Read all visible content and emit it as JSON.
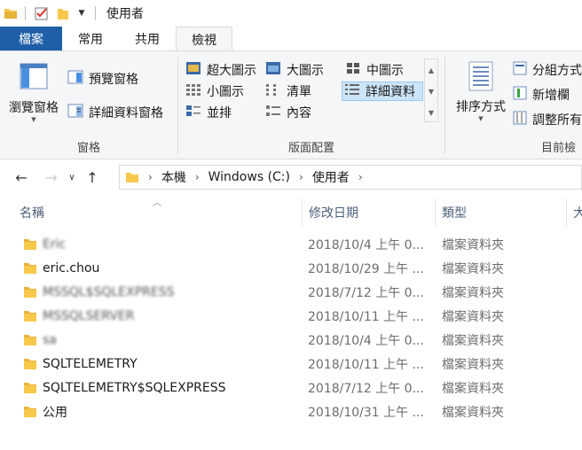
{
  "window": {
    "title": "使用者"
  },
  "quick_access": {
    "icons": [
      "folder-icon",
      "properties-check-icon",
      "new-folder-icon",
      "customize-dropdown-icon"
    ]
  },
  "ribbon_tabs": [
    {
      "label": "檔案"
    },
    {
      "label": "常用"
    },
    {
      "label": "共用"
    },
    {
      "label": "檢視",
      "active": true
    }
  ],
  "ribbon": {
    "panes": {
      "navigation_pane": "瀏覽窗格",
      "preview_pane": "預覽窗格",
      "details_pane": "詳細資料窗格",
      "group_label": "窗格"
    },
    "layout": {
      "items": [
        "超大圖示",
        "大圖示",
        "中圖示",
        "小圖示",
        "清單",
        "詳細資料",
        "並排",
        "內容"
      ],
      "selected": "詳細資料",
      "group_label": "版面配置"
    },
    "current_view": {
      "sort_by": "排序方式",
      "group_by": "分組方式",
      "add_columns": "新增欄",
      "size_all_columns": "調整所有",
      "group_label": "目前檢"
    }
  },
  "address_bar": {
    "breadcrumbs": [
      "本機",
      "Windows (C:)",
      "使用者"
    ]
  },
  "columns": {
    "name": "名稱",
    "date_modified": "修改日期",
    "type": "類型",
    "size": "大"
  },
  "files": [
    {
      "name": "Eric",
      "date": "2018/10/4 上午 0...",
      "type": "檔案資料夾",
      "blurred": true
    },
    {
      "name": "eric.chou",
      "date": "2018/10/29 上午 ...",
      "type": "檔案資料夾",
      "blurred": false
    },
    {
      "name": "MSSQL$SQLEXPRESS",
      "date": "2018/7/12 上午 0...",
      "type": "檔案資料夾",
      "blurred": true
    },
    {
      "name": "MSSQLSERVER",
      "date": "2018/10/11 上午 ...",
      "type": "檔案資料夾",
      "blurred": true
    },
    {
      "name": "sa",
      "date": "2018/10/4 上午 0...",
      "type": "檔案資料夾",
      "blurred": true
    },
    {
      "name": "SQLTELEMETRY",
      "date": "2018/10/11 上午 ...",
      "type": "檔案資料夾",
      "blurred": false
    },
    {
      "name": "SQLTELEMETRY$SQLEXPRESS",
      "date": "2018/7/12 上午 0...",
      "type": "檔案資料夾",
      "blurred": false
    },
    {
      "name": "公用",
      "date": "2018/10/31 上午 ...",
      "type": "檔案資料夾",
      "blurred": false
    }
  ],
  "colors": {
    "file_tab": "#1e5fa8",
    "folder": "#f7c84a",
    "selection": "#cce4f7"
  }
}
